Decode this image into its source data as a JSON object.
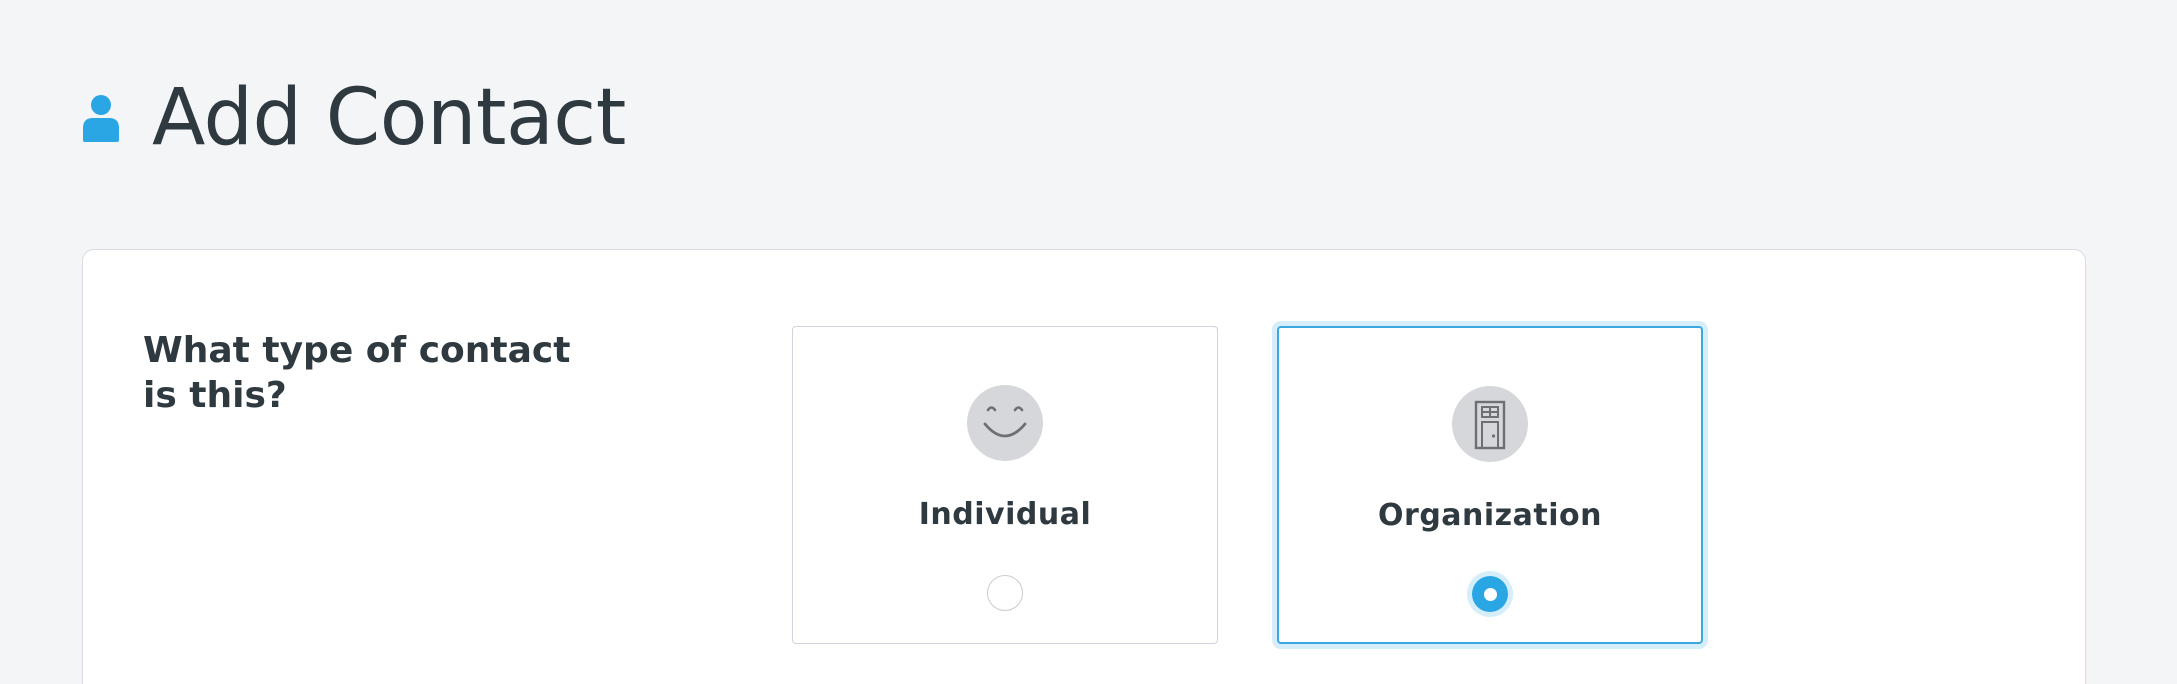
{
  "page": {
    "title": "Add Contact",
    "title_icon": "person-icon",
    "accent_color": "#2aa6e5"
  },
  "form": {
    "question": "What type of contact is this?",
    "options": [
      {
        "label": "Individual",
        "icon": "smiley-face-icon",
        "selected": false
      },
      {
        "label": "Organization",
        "icon": "building-door-icon",
        "selected": true
      }
    ]
  }
}
